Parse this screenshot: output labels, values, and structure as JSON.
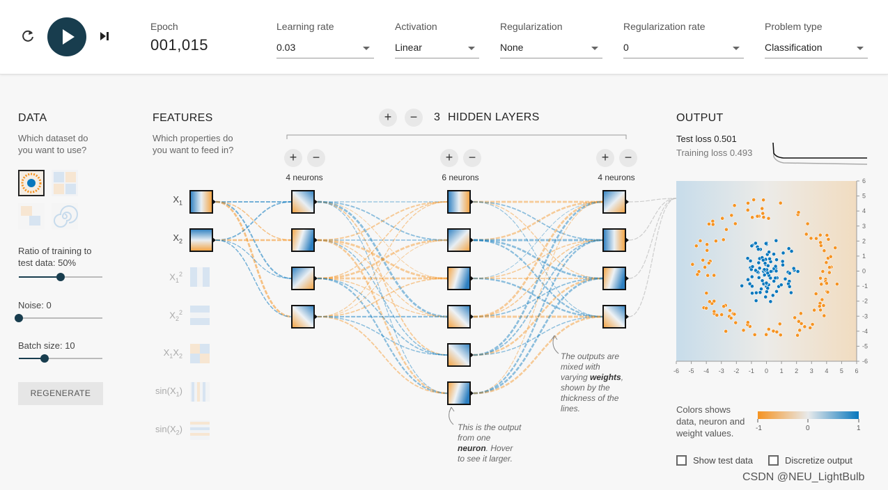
{
  "controls": {
    "epoch_label": "Epoch",
    "epoch_value": "001,015",
    "learning_rate": {
      "label": "Learning rate",
      "value": "0.03"
    },
    "activation": {
      "label": "Activation",
      "value": "Linear"
    },
    "regularization": {
      "label": "Regularization",
      "value": "None"
    },
    "regularization_rate": {
      "label": "Regularization rate",
      "value": "0"
    },
    "problem_type": {
      "label": "Problem type",
      "value": "Classification"
    }
  },
  "data_panel": {
    "title": "DATA",
    "subtitle_line1": "Which dataset do",
    "subtitle_line2": "you want to use?",
    "ratio_label_line1": "Ratio of training to",
    "ratio_label_line2": "test data:  50%",
    "ratio_value": 0.5,
    "noise_label": "Noise:  0",
    "noise_value": 0,
    "batch_label": "Batch size:  10",
    "batch_value": 0.3,
    "regenerate": "REGENERATE"
  },
  "features_panel": {
    "title": "FEATURES",
    "subtitle_line1": "Which properties do",
    "subtitle_line2": "you want to feed in?",
    "features": [
      {
        "main": "X",
        "sub": "1",
        "sup": ""
      },
      {
        "main": "X",
        "sub": "2",
        "sup": ""
      },
      {
        "main": "X",
        "sub": "1",
        "sup": "2"
      },
      {
        "main": "X",
        "sub": "2",
        "sup": "2"
      },
      {
        "main": "X",
        "sub": "1",
        "main2": "X",
        "sub2": "2"
      },
      {
        "main": "sin(X",
        "sub": "1",
        "tail": ")"
      },
      {
        "main": "sin(X",
        "sub": "2",
        "tail": ")"
      }
    ]
  },
  "network": {
    "hidden_layers_count": "3",
    "hidden_layers_label": "HIDDEN LAYERS",
    "layer1_count": "4 neurons",
    "layer2_count": "6 neurons",
    "layer3_count": "4 neurons",
    "note_neuron_1": "This is the output",
    "note_neuron_2": "from one",
    "note_neuron_3": "neuron",
    "note_neuron_3b": ". Hover",
    "note_neuron_4": "to see it larger.",
    "note_weights_1": "The outputs are",
    "note_weights_2": "mixed with",
    "note_weights_3": "varying ",
    "note_weights_3b": "weights",
    "note_weights_3c": ",",
    "note_weights_4": "shown by the",
    "note_weights_5": "thickness of the",
    "note_weights_6": "lines."
  },
  "output_panel": {
    "title": "OUTPUT",
    "test_loss_label": "Test loss ",
    "test_loss_value": "0.501",
    "training_loss_label": "Training loss ",
    "training_loss_value": "0.493",
    "axis_ticks": [
      "-6",
      "-5",
      "-4",
      "-3",
      "-2",
      "-1",
      "0",
      "1",
      "2",
      "3",
      "4",
      "5",
      "6"
    ],
    "y_ticks": [
      "6",
      "5",
      "4",
      "3",
      "2",
      "1",
      "0",
      "-1",
      "-2",
      "-3",
      "-4",
      "-5",
      "-6"
    ],
    "legend_line1": "Colors shows",
    "legend_line2": "data, neuron and",
    "legend_line3": "weight values.",
    "legend_min": "-1",
    "legend_mid": "0",
    "legend_max": "1",
    "show_test_data": "Show test data",
    "discretize_output": "Discretize output"
  },
  "colors": {
    "blue": "#0877bd",
    "orange": "#f59322",
    "dark": "#183d4e"
  },
  "watermark": "CSDN @NEU_LightBulb"
}
